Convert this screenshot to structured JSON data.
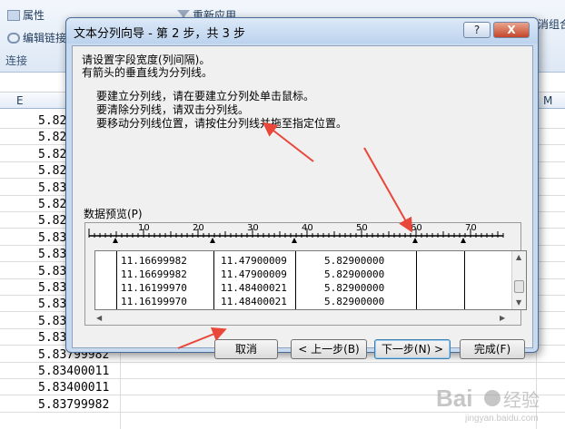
{
  "ribbon": {
    "properties_label": "属性",
    "edit_links_label": "编辑链接",
    "connections_group": "连接",
    "reapply_label": "重新应用",
    "combine_label": "消组合"
  },
  "columns": {
    "E": "E",
    "M": "M"
  },
  "cells": [
    "5.82",
    "5.82",
    "5.82",
    "5.82",
    "5.83",
    "5.82",
    "5.82",
    "5.83",
    "5.83",
    "5.83",
    "5.83",
    "5.83",
    "5.83",
    "5.83799982",
    "5.83799982",
    "5.83400011",
    "5.83400011",
    "5.83799982"
  ],
  "dialog": {
    "title": "文本分列向导 - 第 2 步，共 3 步",
    "help": "?",
    "close": "X",
    "instructions": [
      "请设置字段宽度(列间隔)。",
      "有箭头的垂直线为分列线。"
    ],
    "tips": [
      "要建立分列线，请在要建立分列处单击鼠标。",
      "要清除分列线，请双击分列线。",
      "要移动分列线位置，请按住分列线并拖至指定位置。"
    ],
    "preview_label": "数据预览(P)",
    "ruler_ticks": [
      "10",
      "20",
      "30",
      "40",
      "50",
      "60",
      "70"
    ],
    "preview_rows": [
      [
        "11.16699982",
        "11.47900009",
        "5.82900000"
      ],
      [
        "11.16699982",
        "11.47900009",
        "5.82900000"
      ],
      [
        "11.16199970",
        "11.48400021",
        "5.82900000"
      ],
      [
        "11.16199970",
        "11.48400021",
        "5.82900000"
      ]
    ],
    "buttons": {
      "cancel": "取消",
      "back": "< 上一步(B)",
      "next": "下一步(N) >",
      "finish": "完成(F)"
    }
  },
  "watermark": {
    "brand": "Baidu",
    "sub": "经验",
    "url": "jingyan.baidu.com"
  },
  "colors": {
    "annotation": "#e8473a",
    "dialog_frame": "#c7daf0"
  }
}
